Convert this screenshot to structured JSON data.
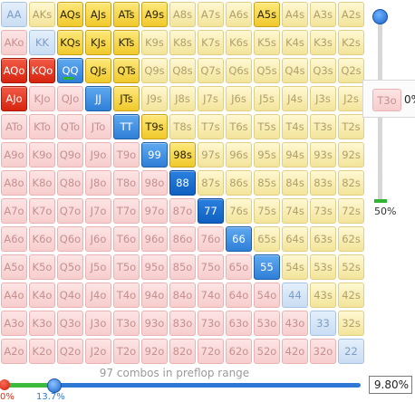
{
  "grid": {
    "rows": [
      [
        "AA",
        "AKs",
        "AQs",
        "AJs",
        "ATs",
        "A9s",
        "A8s",
        "A7s",
        "A6s",
        "A5s",
        "A4s",
        "A3s",
        "A2s"
      ],
      [
        "AKo",
        "KK",
        "KQs",
        "KJs",
        "KTs",
        "K9s",
        "K8s",
        "K7s",
        "K6s",
        "K5s",
        "K4s",
        "K3s",
        "K2s"
      ],
      [
        "AQo",
        "KQo",
        "QQ",
        "QJs",
        "QTs",
        "Q9s",
        "Q8s",
        "Q7s",
        "Q6s",
        "Q5s",
        "Q4s",
        "Q3s",
        "Q2s"
      ],
      [
        "AJo",
        "KJo",
        "QJo",
        "JJ",
        "JTs",
        "J9s",
        "J8s",
        "J7s",
        "J6s",
        "J5s",
        "J4s",
        "J3s",
        "J2s"
      ],
      [
        "ATo",
        "KTo",
        "QTo",
        "JTo",
        "TT",
        "T9s",
        "T8s",
        "T7s",
        "T6s",
        "T5s",
        "T4s",
        "T3s",
        "T2s"
      ],
      [
        "A9o",
        "K9o",
        "Q9o",
        "J9o",
        "T9o",
        "99",
        "98s",
        "97s",
        "96s",
        "95s",
        "94s",
        "93s",
        "92s"
      ],
      [
        "A8o",
        "K8o",
        "Q8o",
        "J8o",
        "T8o",
        "98o",
        "88",
        "87s",
        "86s",
        "85s",
        "84s",
        "83s",
        "82s"
      ],
      [
        "A7o",
        "K7o",
        "Q7o",
        "J7o",
        "T7o",
        "97o",
        "87o",
        "77",
        "76s",
        "75s",
        "74s",
        "73s",
        "72s"
      ],
      [
        "A6o",
        "K6o",
        "Q6o",
        "J6o",
        "T6o",
        "96o",
        "86o",
        "76o",
        "66",
        "65s",
        "64s",
        "63s",
        "62s"
      ],
      [
        "A5o",
        "K5o",
        "Q5o",
        "J5o",
        "T5o",
        "95o",
        "85o",
        "75o",
        "65o",
        "55",
        "54s",
        "53s",
        "52s"
      ],
      [
        "A4o",
        "K4o",
        "Q4o",
        "J4o",
        "T4o",
        "94o",
        "84o",
        "74o",
        "64o",
        "54o",
        "44",
        "43s",
        "42s"
      ],
      [
        "A3o",
        "K3o",
        "Q3o",
        "J3o",
        "T3o",
        "93o",
        "83o",
        "73o",
        "63o",
        "53o",
        "43o",
        "33",
        "32s"
      ],
      [
        "A2o",
        "K2o",
        "Q2o",
        "J2o",
        "T2o",
        "92o",
        "82o",
        "72o",
        "62o",
        "52o",
        "42o",
        "32o",
        "22"
      ]
    ],
    "selected": [
      "AQs",
      "AJs",
      "ATs",
      "A9s",
      "A5s",
      "KQs",
      "KJs",
      "KTs",
      "AQo",
      "KQo",
      "QQ",
      "QJs",
      "QTs",
      "AJo",
      "JJ",
      "JTs",
      "TT",
      "T9s",
      "99",
      "98s",
      "88",
      "77",
      "66",
      "55"
    ]
  },
  "tooltip": {
    "hand": "T3o",
    "value": "0%"
  },
  "vertical_slider": {
    "label": "50%",
    "value": 0.5
  },
  "footer": {
    "combos_text": "97 combos in preflop range",
    "left_label": "0%",
    "right_label": "13.7%",
    "percent_value": "9.80%",
    "slider_low": 0.0,
    "slider_high": 0.137
  },
  "colors": {
    "suited": "#f3e49a",
    "offsuit": "#f7cdcd",
    "pair": "#c9ddf3",
    "selected_suited": "#f0c92b",
    "selected_offsuit": "#d8250f",
    "selected_pair": "#2f7fd8",
    "slider_blue": "#2f79d6",
    "slider_green": "#3dbb3d"
  }
}
